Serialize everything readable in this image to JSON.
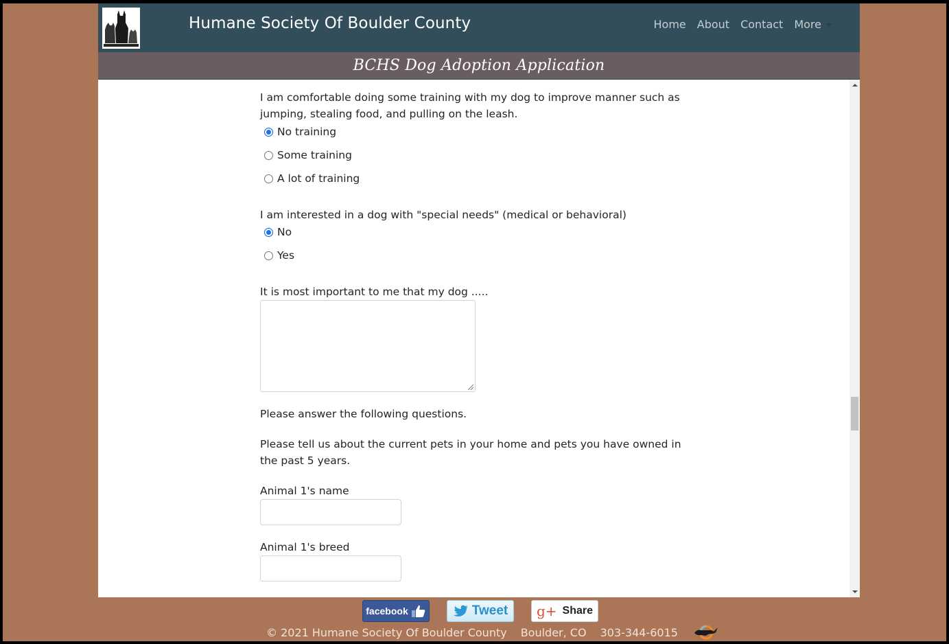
{
  "colors": {
    "page_background": "#ab7657",
    "navbar": "#324e5a",
    "title_bar": "#695c62",
    "radio_checked": "#1a73e8"
  },
  "navbar": {
    "logo_icon": "humane-society-logo",
    "brand": "Humane Society Of Boulder County",
    "links": [
      {
        "label": "Home"
      },
      {
        "label": "About"
      },
      {
        "label": "Contact"
      },
      {
        "label": "More",
        "has_dropdown": true
      }
    ]
  },
  "page_title": "BCHS Dog Adoption Application",
  "form": {
    "training_question": {
      "label": "I am comfortable doing some training with my dog to improve manner such as jumping, stealing food, and pulling on the leash.",
      "options": [
        {
          "label": "No training",
          "checked": true
        },
        {
          "label": "Some training",
          "checked": false
        },
        {
          "label": "A lot of training",
          "checked": false
        }
      ]
    },
    "special_needs_question": {
      "label": "I am interested in a dog with \"special needs\" (medical or behavioral)",
      "options": [
        {
          "label": "No",
          "checked": true
        },
        {
          "label": "Yes",
          "checked": false
        }
      ]
    },
    "important_question": {
      "label": "It is most important to me that my dog .....",
      "value": ""
    },
    "instructions": "Please answer the following questions.",
    "pets_intro": "Please tell us about the current pets in your home and pets you have owned in the past 5 years.",
    "animal1_name": {
      "label": "Animal 1's name",
      "value": ""
    },
    "animal1_breed": {
      "label": "Animal 1's breed",
      "value": ""
    }
  },
  "footer": {
    "share_buttons": [
      {
        "label": "facebook",
        "icon": "thumbs-up-icon"
      },
      {
        "label": "Tweet",
        "icon": "twitter-bird-icon"
      },
      {
        "label": "Share",
        "icon": "google-plus-icon",
        "icon_text": "g+"
      }
    ],
    "copyright": "© 2021 Humane Society Of Boulder County",
    "location": "Boulder, CO",
    "phone": "303-344-6015",
    "badge_icon": "leaping-cat-icon"
  }
}
